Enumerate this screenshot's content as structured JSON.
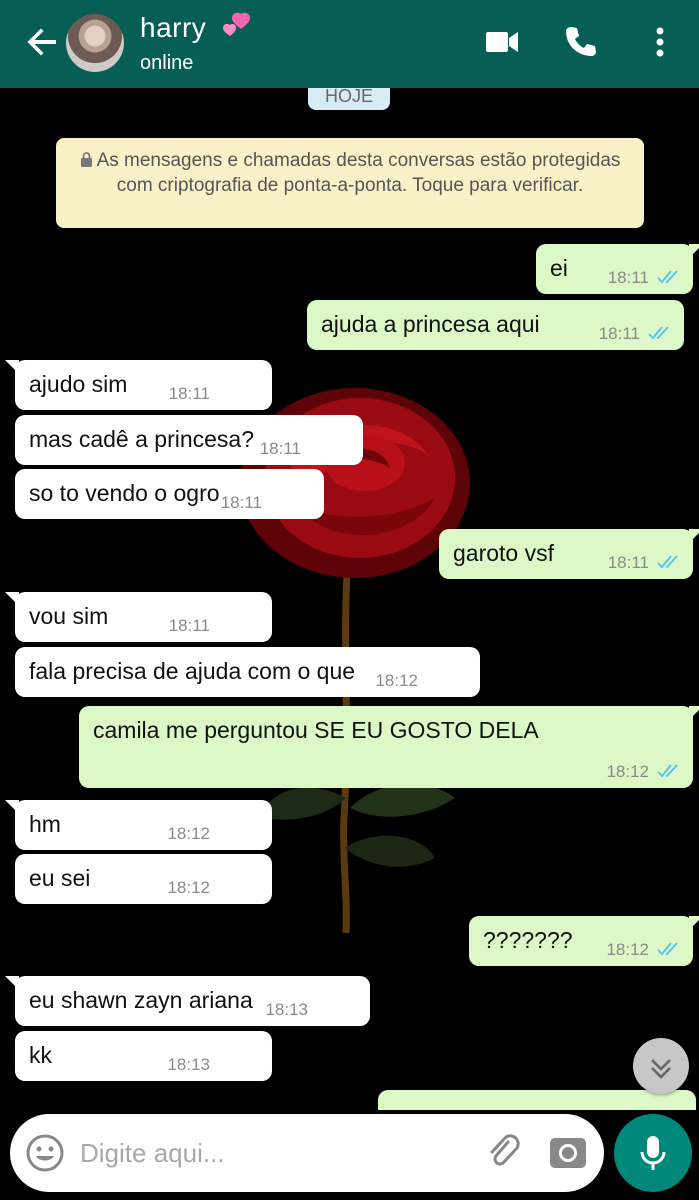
{
  "header": {
    "contact_name": "harry",
    "status": "online",
    "back_icon": "arrow-left-icon",
    "video_icon": "video-camera-icon",
    "call_icon": "phone-icon",
    "menu_icon": "more-vert-icon"
  },
  "chat": {
    "date_chip": "HOJE",
    "encryption_notice": "As mensagens e chamadas desta conversas estão protegidas com criptografia de ponta-a-ponta. Toque para verificar.",
    "messages": [
      {
        "dir": "out",
        "text": "ei",
        "time": "18:11"
      },
      {
        "dir": "out",
        "text": "ajuda a princesa aqui",
        "time": "18:11"
      },
      {
        "dir": "in",
        "text": "ajudo sim",
        "time": "18:11"
      },
      {
        "dir": "in",
        "text": "mas cadê a princesa?",
        "time": "18:11"
      },
      {
        "dir": "in",
        "text": "so to vendo o ogro",
        "time": "18:11"
      },
      {
        "dir": "out",
        "text": "garoto vsf",
        "time": "18:11"
      },
      {
        "dir": "in",
        "text": "vou sim",
        "time": "18:11"
      },
      {
        "dir": "in",
        "text": "fala precisa de ajuda com o que",
        "time": "18:12"
      },
      {
        "dir": "out",
        "text": "camila me perguntou SE EU GOSTO DELA",
        "time": "18:12"
      },
      {
        "dir": "in",
        "text": "hm",
        "time": "18:12"
      },
      {
        "dir": "in",
        "text": "eu sei",
        "time": "18:12"
      },
      {
        "dir": "out",
        "text": "???????",
        "time": "18:12"
      },
      {
        "dir": "in",
        "text": "eu shawn zayn ariana",
        "time": "18:13"
      },
      {
        "dir": "in",
        "text": "kk",
        "time": "18:13"
      }
    ],
    "colors": {
      "header": "#075e54",
      "incoming": "#ffffff",
      "outgoing": "#dcf8c6",
      "read_ticks": "#4fc3f7",
      "notice": "#fbf1c8",
      "mic": "#00897b"
    }
  },
  "composer": {
    "placeholder": "Digite aqui...",
    "emoji_icon": "smiley-icon",
    "attach_icon": "paperclip-icon",
    "camera_icon": "camera-icon",
    "mic_icon": "microphone-icon"
  },
  "scroll_icon": "chevron-double-down-icon"
}
